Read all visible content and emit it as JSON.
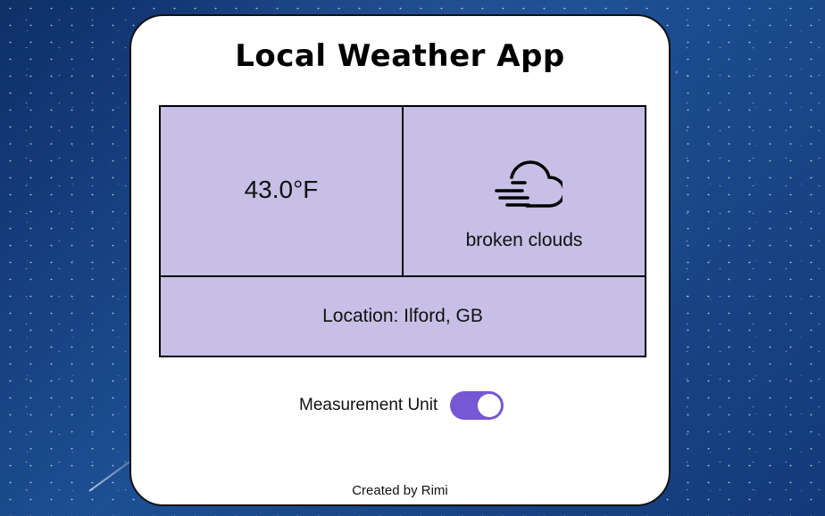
{
  "app": {
    "title": "Local Weather App"
  },
  "weather": {
    "temperature": "43.0°F",
    "description": "broken clouds",
    "location": "Location: Ilford, GB",
    "icon": "broken-clouds-icon"
  },
  "controls": {
    "measurement_unit_label": "Measurement Unit",
    "unit_toggle_state": "on",
    "toggle_color": "#7657d4"
  },
  "footer": {
    "credit": "Created by Rimi"
  },
  "colors": {
    "panel_fill": "#c7bfe5",
    "card_background": "#ffffff",
    "accent": "#7657d4"
  }
}
